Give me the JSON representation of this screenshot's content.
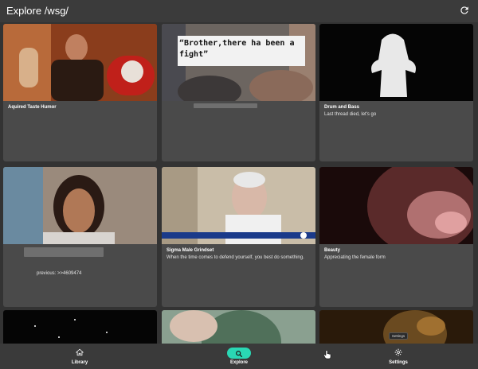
{
  "appbar": {
    "title": "Explore /wsg/",
    "refresh_icon": "refresh-icon"
  },
  "cards": [
    {
      "title": "Aquired Taste Humor",
      "text": ""
    },
    {
      "title": "",
      "text": "",
      "thumb_caption": "“Brother,there ha been a fight”"
    },
    {
      "title": "Drum and Bass",
      "text": "Last thread died, let's go"
    },
    {
      "title": "",
      "text": "previous: >>4609474"
    },
    {
      "title": "Sigma Male Grindset",
      "text": "When the time comes to defend yourself, you best do something."
    },
    {
      "title": "Beauty",
      "text": "Appreciating the female form"
    },
    {
      "title": "",
      "text": ""
    },
    {
      "title": "",
      "text": ""
    },
    {
      "title": "",
      "text": ""
    }
  ],
  "nav": {
    "items": [
      {
        "label": "Library",
        "icon": "home-icon"
      },
      {
        "label": "Explore",
        "icon": "search-icon"
      },
      {
        "label": "Settings",
        "icon": "gear-icon"
      }
    ],
    "active": "Explore",
    "active_color": "#2ad7b4"
  },
  "tooltip": "Settings"
}
